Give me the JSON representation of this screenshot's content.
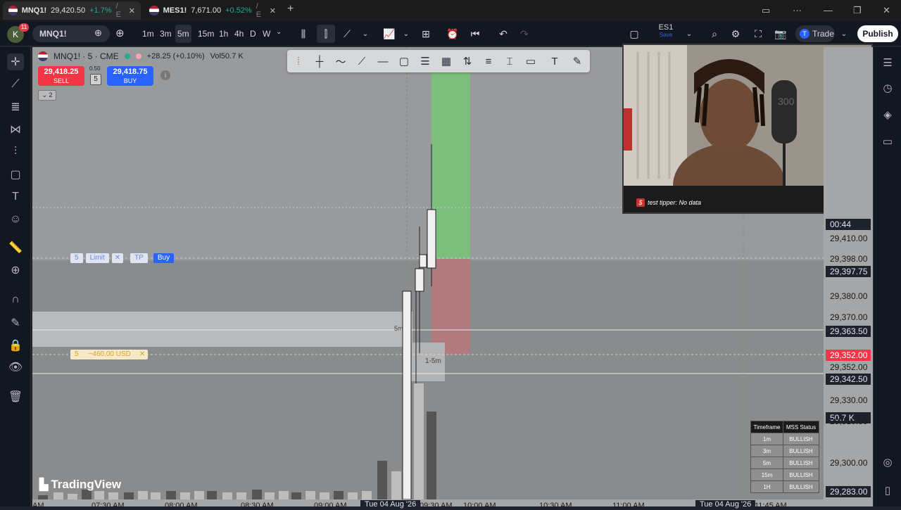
{
  "browser": {
    "tabs": [
      {
        "label": "MNQ1!",
        "price": "29,420.50",
        "change": "+1.7%",
        "rest": "/ E"
      },
      {
        "label": "MES1!",
        "price": "7,671.00",
        "change": "+0.52%",
        "rest": "/ E"
      }
    ]
  },
  "toolbar": {
    "avatar_letter": "K",
    "notif_count": "11",
    "symbol": "MNQ1!",
    "intervals": [
      "1m",
      "3m",
      "5m",
      "15m",
      "1h",
      "4h",
      "D",
      "W"
    ],
    "active_interval": "5m",
    "layout_name": "ES1",
    "layout_sub": "Save",
    "trade_label": "Trade",
    "publish_label": "Publish"
  },
  "legend": {
    "title": "MNQ1! · 5 · CME",
    "change": "+28.25 (+0.10%)",
    "volume": "Vol50.7 K",
    "sell_price": "29,418.25",
    "sell_label": "SELL",
    "spread": "0.50",
    "qty": "5",
    "buy_price": "29,418.75",
    "buy_label": "BUY",
    "collapse": "2"
  },
  "order_line": {
    "qty": "5",
    "type": "Limit",
    "tp": "TP",
    "side": "Buy"
  },
  "sl_line": {
    "qty": "5",
    "pnl": "−460.00 USD"
  },
  "chart_labels": {
    "timer_5m": "5m",
    "tf_label": "1-5m"
  },
  "watermark": "TradingView",
  "webcam": {
    "ticker_text": "test tipper: No data",
    "mic_text": "300"
  },
  "price_axis": [
    {
      "text": "00:44",
      "style": "boxed"
    },
    {
      "text": "29,410.00",
      "style": "plain"
    },
    {
      "text": "29,398.00",
      "style": "plain"
    },
    {
      "text": "29,397.75",
      "style": "boxed"
    },
    {
      "text": "29,380.00",
      "style": "plain"
    },
    {
      "text": "29,370.00",
      "style": "plain"
    },
    {
      "text": "29,363.50",
      "style": "boxed"
    },
    {
      "text": "29,352.00",
      "style": "red"
    },
    {
      "text": "29,352.00",
      "style": "plain"
    },
    {
      "text": "29,342.50",
      "style": "boxed"
    },
    {
      "text": "29,330.00",
      "style": "plain"
    },
    {
      "text": "50.7 K",
      "style": "boxed"
    },
    {
      "text": "29,310.00",
      "style": "plain"
    },
    {
      "text": "29,300.00",
      "style": "plain"
    },
    {
      "text": "29,283.00",
      "style": "boxed"
    }
  ],
  "time_axis": [
    "AM",
    "07:30 AM",
    "08:00 AM",
    "08:30 AM",
    "09:00 AM",
    "Tue 04 Aug '26",
    "09:30 AM",
    "10:00 AM",
    "10:30 AM",
    "11:00 AM",
    "Tue 04 Aug '26",
    "11:45 AM"
  ],
  "mss": {
    "headers": [
      "Timeframe",
      "MSS Status"
    ],
    "rows": [
      [
        "1m",
        "BULLISH"
      ],
      [
        "3m",
        "BULLISH"
      ],
      [
        "5m",
        "BULLISH"
      ],
      [
        "15m",
        "BULLISH"
      ],
      [
        "1H",
        "BULLISH"
      ]
    ]
  }
}
